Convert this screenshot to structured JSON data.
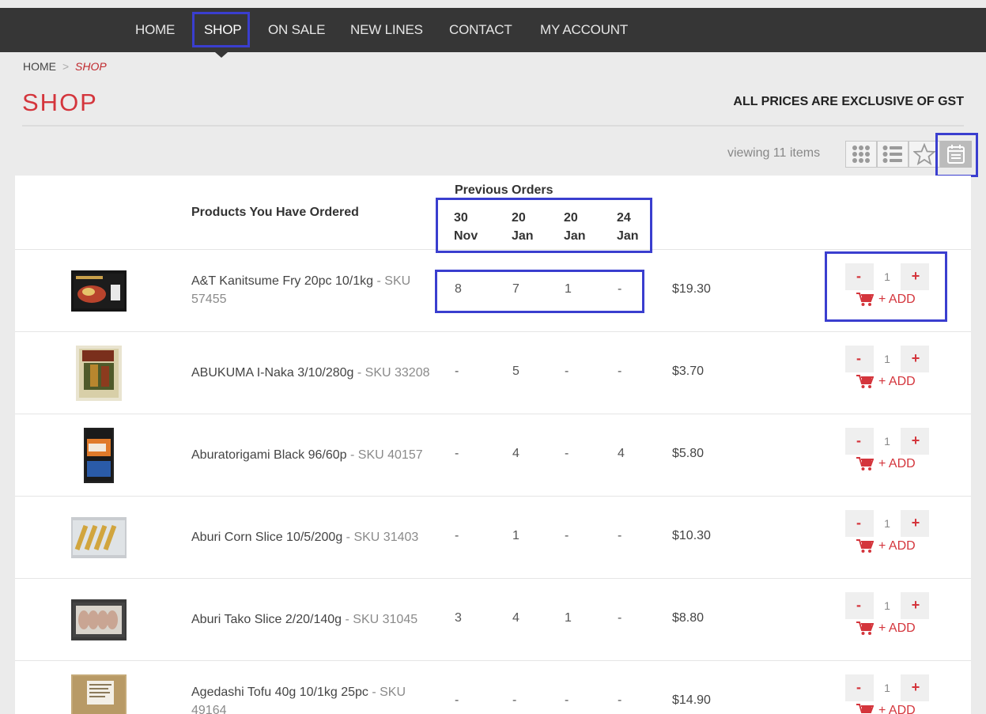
{
  "nav": {
    "items": [
      "HOME",
      "SHOP",
      "ON SALE",
      "NEW LINES",
      "CONTACT",
      "MY ACCOUNT"
    ],
    "active": "SHOP"
  },
  "breadcrumb": {
    "home": "HOME",
    "separator": ">",
    "current": "SHOP"
  },
  "page": {
    "title": "SHOP",
    "gst_note": "ALL PRICES ARE EXCLUSIVE OF GST"
  },
  "toolbar": {
    "viewing": "viewing 11 items",
    "views": [
      "grid-icon",
      "list-icon",
      "star-icon",
      "calendar-icon"
    ],
    "active_view": "calendar-icon"
  },
  "table": {
    "products_header": "Products You Have Ordered",
    "previous_orders_header": "Previous Orders",
    "dates": [
      {
        "day": "30",
        "month": "Nov"
      },
      {
        "day": "20",
        "month": "Jan"
      },
      {
        "day": "20",
        "month": "Jan"
      },
      {
        "day": "24",
        "month": "Jan"
      }
    ],
    "rows": [
      {
        "name": "A&T Kanitsume Fry 20pc 10/1kg",
        "sku": " - SKU 57455",
        "orders": [
          "8",
          "7",
          "1",
          "-"
        ],
        "price": "$19.30",
        "qty": "1",
        "add_label": "+ ADD"
      },
      {
        "name": "ABUKUMA I-Naka 3/10/280g",
        "sku": " - SKU 33208",
        "orders": [
          "-",
          "5",
          "-",
          "-"
        ],
        "price": "$3.70",
        "qty": "1",
        "add_label": "+ ADD"
      },
      {
        "name": "Aburatorigami Black 96/60p",
        "sku": " - SKU 40157",
        "orders": [
          "-",
          "4",
          "-",
          "4"
        ],
        "price": "$5.80",
        "qty": "1",
        "add_label": "+ ADD"
      },
      {
        "name": "Aburi Corn Slice 10/5/200g",
        "sku": " - SKU 31403",
        "orders": [
          "-",
          "1",
          "-",
          "-"
        ],
        "price": "$10.30",
        "qty": "1",
        "add_label": "+ ADD"
      },
      {
        "name": "Aburi Tako Slice 2/20/140g",
        "sku": " - SKU 31045",
        "orders": [
          "3",
          "4",
          "1",
          "-"
        ],
        "price": "$8.80",
        "qty": "1",
        "add_label": "+ ADD"
      },
      {
        "name": "Agedashi Tofu 40g 10/1kg 25pc",
        "sku": " - SKU 49164",
        "orders": [
          "-",
          "-",
          "-",
          "-"
        ],
        "price": "$14.90",
        "qty": "1",
        "add_label": "+ ADD"
      }
    ],
    "stepper": {
      "minus": "-",
      "plus": "+"
    }
  },
  "colors": {
    "accent": "#d4353c",
    "nav_bg": "#363636",
    "highlight": "#3a3ecf"
  }
}
